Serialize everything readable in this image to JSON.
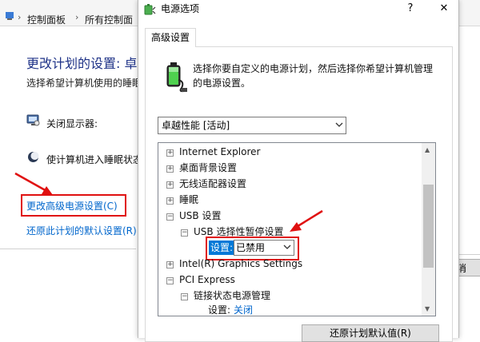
{
  "background": {
    "breadcrumb": [
      "控制面板",
      "所有控制面"
    ],
    "heading": "更改计划的设置: 卓",
    "subtitle": "选择希望计算机使用的睡眠",
    "options": [
      {
        "label": "关闭显示器:",
        "icon": "monitor-icon"
      },
      {
        "label": "使计算机进入睡眠状态",
        "icon": "moon-icon"
      }
    ],
    "links": {
      "advanced": "更改高级电源设置(C)",
      "restore": "还原此计划的默认设置(R)"
    },
    "partial_button": "消"
  },
  "dialog": {
    "title": "电源选项",
    "help": "?",
    "close": "✕",
    "tab": "高级设置",
    "description": "选择你要自定义的电源计划，然后选择你希望计算机管理的电源设置。",
    "plan": "卓越性能 [活动]",
    "tree": [
      {
        "label": "Internet Explorer",
        "expander": "+"
      },
      {
        "label": "桌面背景设置",
        "expander": "+"
      },
      {
        "label": "无线适配器设置",
        "expander": "+"
      },
      {
        "label": "睡眠",
        "expander": "+"
      },
      {
        "label": "USB 设置",
        "expander": "−"
      },
      {
        "label": "USB 选择性暂停设置",
        "expander": "−"
      },
      {
        "label": "Intel(R) Graphics Settings",
        "expander": "+"
      },
      {
        "label": "PCI Express",
        "expander": "−"
      },
      {
        "label": "链接状态电源管理",
        "expander": "−"
      }
    ],
    "usb_setting": {
      "label": "设置:",
      "value": "已禁用"
    },
    "pci_setting": {
      "label": "设置:",
      "value": "关闭"
    },
    "restore_button": "还原计划默认值(R)"
  },
  "colors": {
    "accent": "#0078d7",
    "link": "#0066cc",
    "annotation": "#e01010",
    "heading": "#1e3287"
  }
}
